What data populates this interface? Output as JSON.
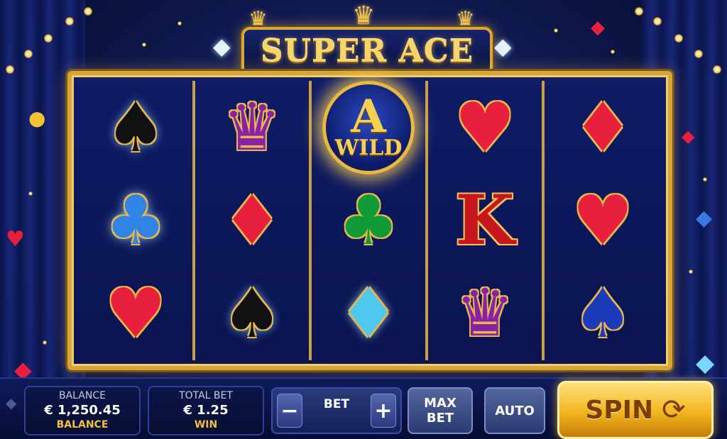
{
  "title": "SUPER ACE",
  "reels": [
    [
      "spade-black",
      "club-blue",
      "heart-red"
    ],
    [
      "crown",
      "diamond-red",
      "spade-black"
    ],
    [
      "wild",
      "club-green",
      "diamond-blue"
    ],
    [
      "heart-red",
      "king",
      "crown"
    ],
    [
      "diamond-red",
      "heart-red",
      "spade-blue"
    ]
  ],
  "symbols": {
    "wild_letter": "A",
    "wild_label": "WILD",
    "king_letter": "K"
  },
  "balance": {
    "label": "BALANCE",
    "value": "€ 1,250.45",
    "sub_label": "BALANCE"
  },
  "total_bet": {
    "label": "TOTAL BET",
    "value": "€ 1.25",
    "sub_label": "WIN"
  },
  "bet": {
    "label": "BET",
    "minus": "−",
    "plus": "+"
  },
  "buttons": {
    "max_bet": "MAX BET",
    "auto": "AUTO",
    "spin": "SPIN"
  },
  "colors": {
    "gold": "#d4a53a",
    "navy": "#0d1648"
  }
}
